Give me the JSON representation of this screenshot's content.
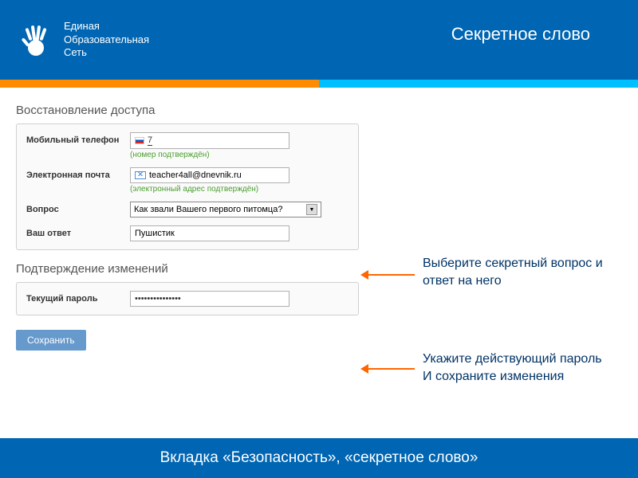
{
  "header": {
    "logo_line1": "Единая",
    "logo_line2": "Образовательная",
    "logo_line3": "Сеть",
    "slide_title": "Секретное слово"
  },
  "section1": {
    "title": "Восстановление доступа",
    "phone": {
      "label": "Мобильный телефон",
      "value": "7",
      "hint": "(номер подтверждён)"
    },
    "email": {
      "label": "Электронная почта",
      "value": "teacher4all@dnevnik.ru",
      "hint": "(электронный адрес подтверждён)"
    },
    "question": {
      "label": "Вопрос",
      "value": "Как звали Вашего первого питомца?"
    },
    "answer": {
      "label": "Ваш ответ",
      "value": "Пушистик"
    }
  },
  "section2": {
    "title": "Подтверждение изменений",
    "password": {
      "label": "Текущий пароль",
      "value": "•••••••••••••••"
    }
  },
  "annotations": {
    "a1": "Выберите секретный вопрос и ответ на него",
    "a2_line1": "Укажите действующий пароль",
    "a2_line2": "И сохраните изменения"
  },
  "save_button": "Сохранить",
  "footer": "Вкладка «Безопасность», «секретное слово»"
}
